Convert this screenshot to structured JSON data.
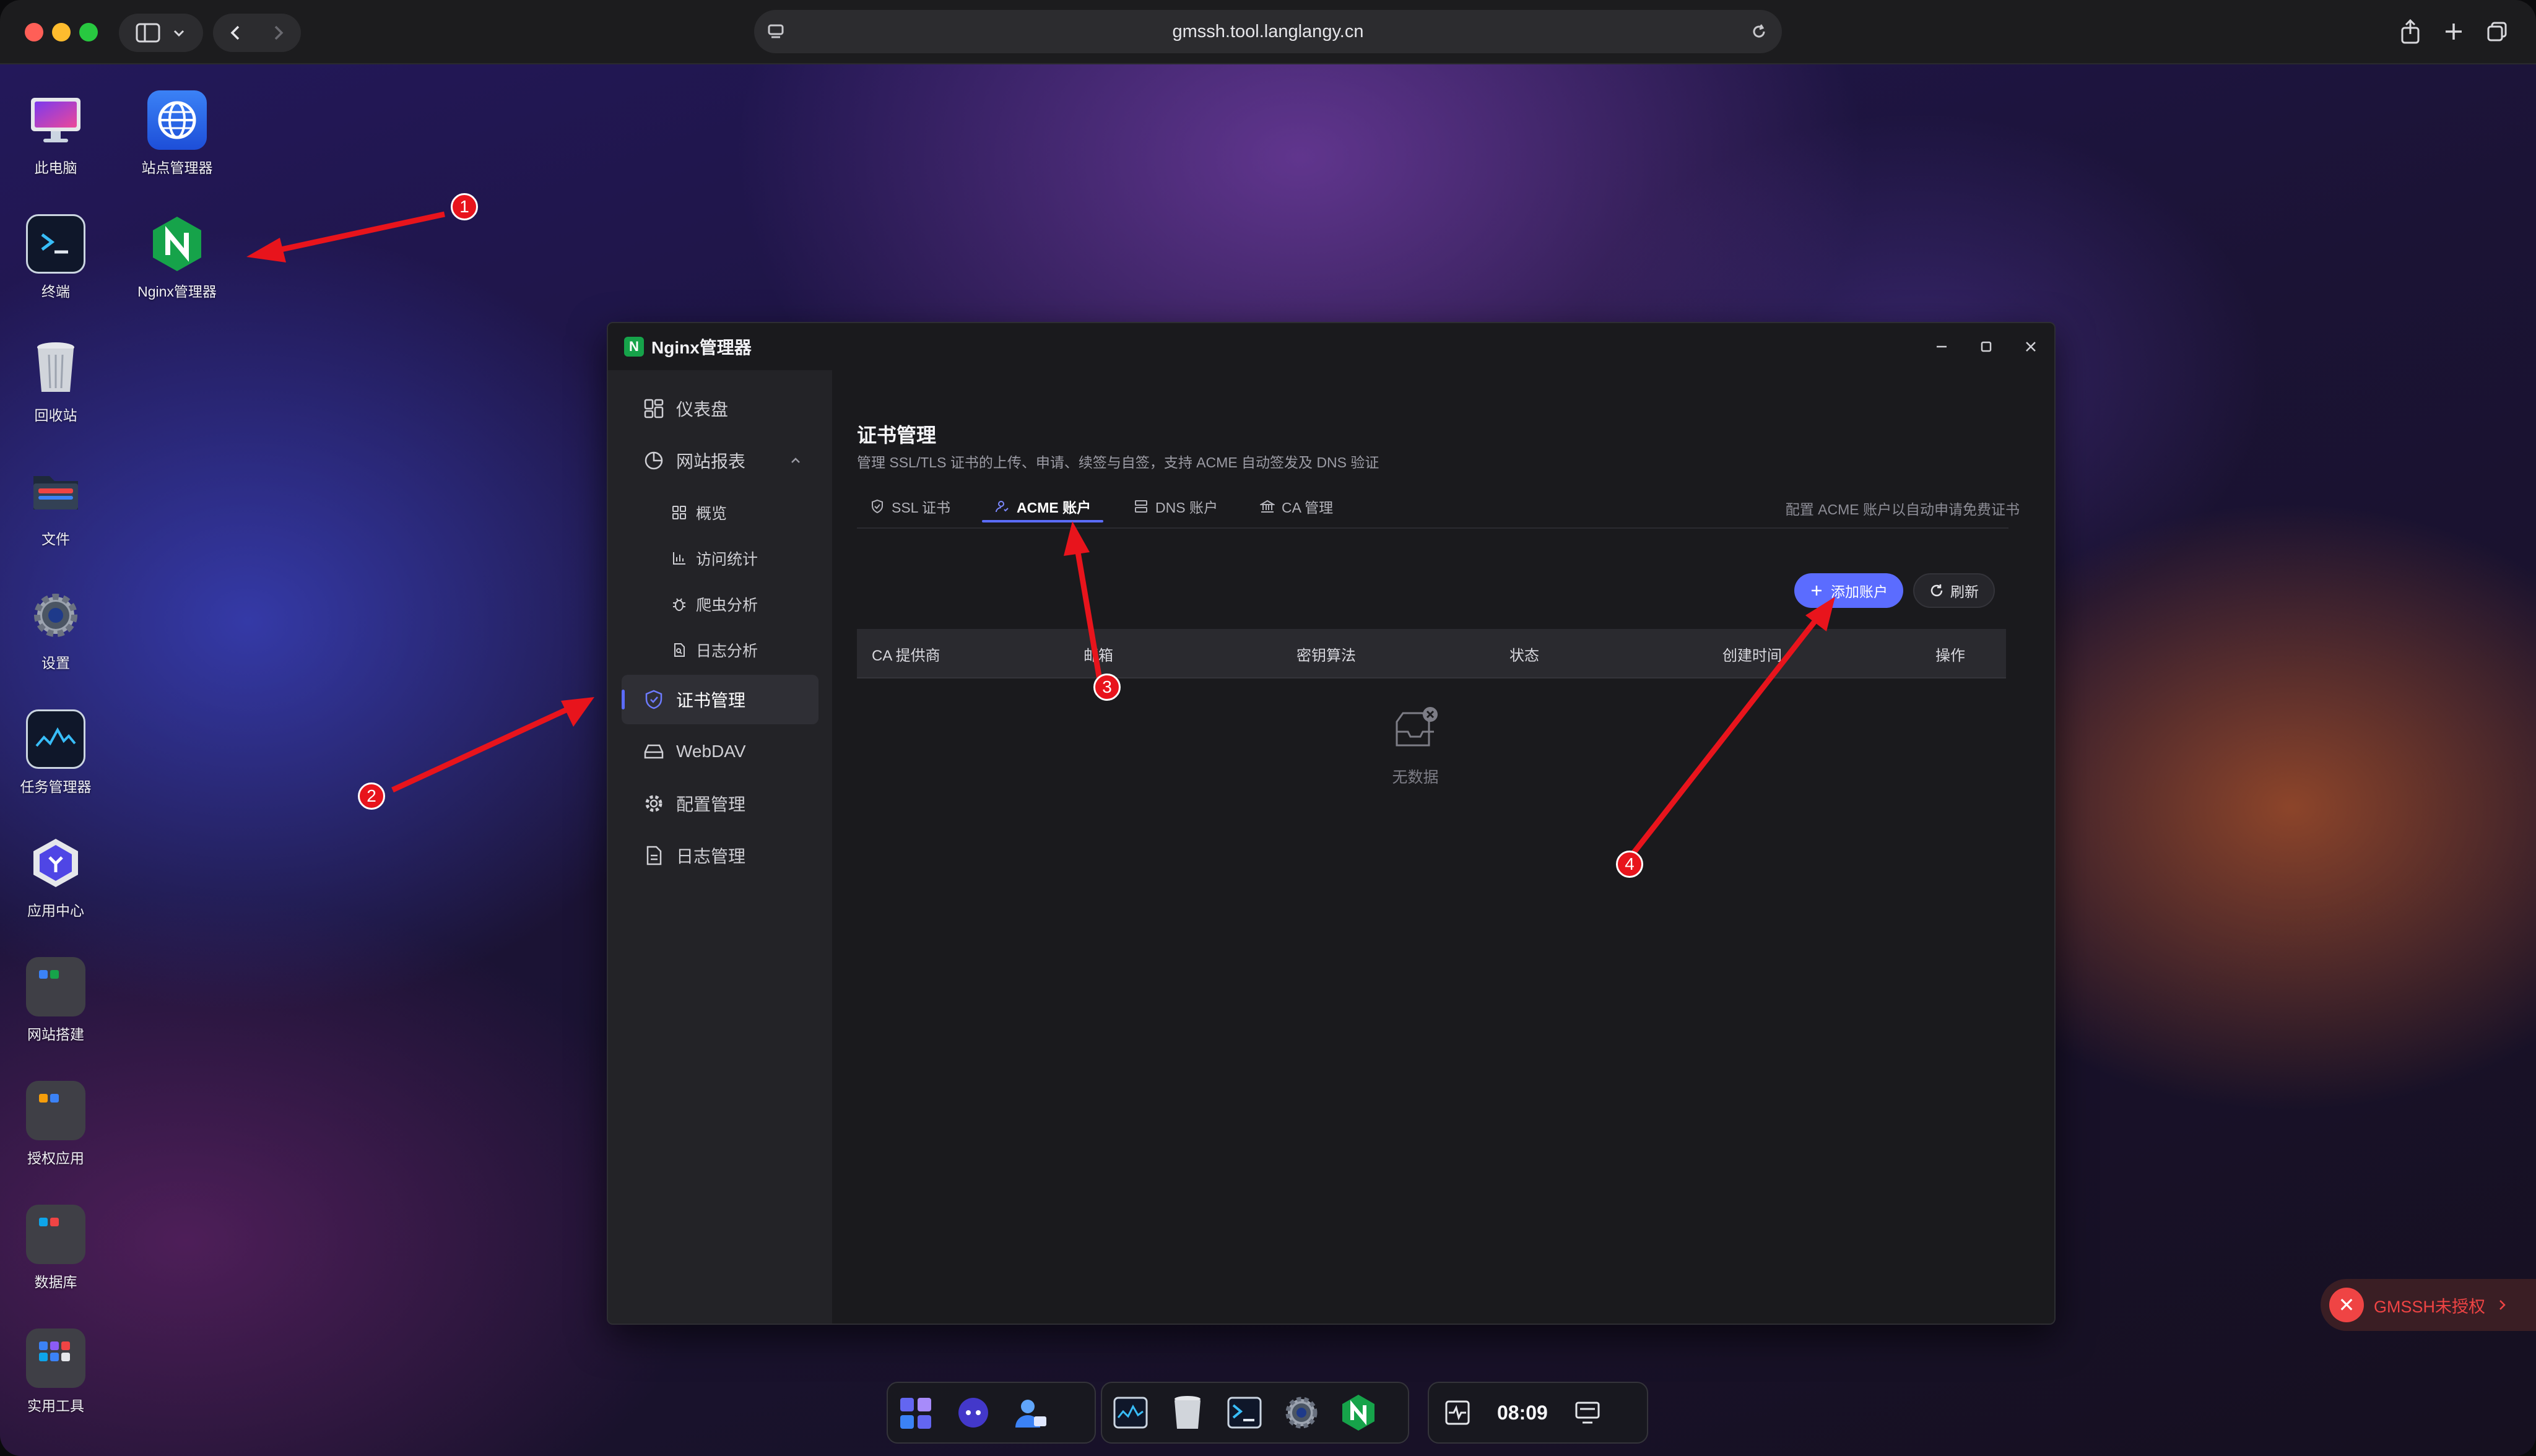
{
  "browser": {
    "url": "gmssh.tool.langlangy.cn",
    "icons": [
      "sidebar-toggle-icon",
      "chevron-down-icon",
      "back-icon",
      "forward-icon",
      "reload-icon",
      "share-icon",
      "new-tab-icon",
      "tabs-overview-icon"
    ]
  },
  "desktop": {
    "icons": [
      {
        "label": "此电脑",
        "icon": "monitor-icon"
      },
      {
        "label": "站点管理器",
        "icon": "globe-icon"
      },
      {
        "label": "终端",
        "icon": "terminal-icon"
      },
      {
        "label": "Nginx管理器",
        "icon": "nginx-icon"
      },
      {
        "label": "回收站",
        "icon": "trash-icon"
      },
      {
        "label": "文件",
        "icon": "folder-icon"
      },
      {
        "label": "设置",
        "icon": "gear-icon"
      },
      {
        "label": "任务管理器",
        "icon": "activity-icon"
      },
      {
        "label": "应用中心",
        "icon": "app-center-icon"
      },
      {
        "label": "网站搭建",
        "icon": "folder-group-icon"
      },
      {
        "label": "授权应用",
        "icon": "folder-group-icon"
      },
      {
        "label": "数据库",
        "icon": "folder-group-icon"
      },
      {
        "label": "实用工具",
        "icon": "folder-group-icon"
      }
    ]
  },
  "window": {
    "title": "Nginx管理器",
    "logo_letter": "N",
    "controls": [
      "minimize-icon",
      "maximize-icon",
      "close-icon"
    ]
  },
  "sidebar": {
    "items": [
      {
        "label": "仪表盘",
        "icon": "dashboard-icon"
      },
      {
        "label": "网站报表",
        "icon": "chart-pie-icon",
        "expanded": true
      },
      {
        "label": "概览",
        "icon": "grid-icon"
      },
      {
        "label": "访问统计",
        "icon": "bar-chart-icon"
      },
      {
        "label": "爬虫分析",
        "icon": "bug-icon"
      },
      {
        "label": "日志分析",
        "icon": "file-search-icon"
      },
      {
        "label": "证书管理",
        "icon": "shield-icon",
        "active": true
      },
      {
        "label": "WebDAV",
        "icon": "drive-icon"
      },
      {
        "label": "配置管理",
        "icon": "gear-icon"
      },
      {
        "label": "日志管理",
        "icon": "document-icon"
      }
    ]
  },
  "main": {
    "title": "证书管理",
    "description": "管理 SSL/TLS 证书的上传、申请、续签与自签，支持 ACME 自动签发及 DNS 验证",
    "tabs": [
      {
        "label": "SSL 证书",
        "icon": "shield-icon"
      },
      {
        "label": "ACME 账户",
        "icon": "user-icon",
        "active": true
      },
      {
        "label": "DNS 账户",
        "icon": "server-icon"
      },
      {
        "label": "CA 管理",
        "icon": "bank-icon"
      }
    ],
    "tab_hint": "配置 ACME 账户以自动申请免费证书",
    "add_button": "添加账户",
    "refresh_button": "刷新",
    "table": {
      "columns": [
        "CA 提供商",
        "邮箱",
        "密钥算法",
        "状态",
        "创建时间",
        "操作"
      ],
      "rows": []
    },
    "empty_text": "无数据"
  },
  "annotations": [
    "1",
    "2",
    "3",
    "4"
  ],
  "badge": {
    "text": "GMSSH未授权"
  },
  "dock": {
    "clock": "08:09",
    "items": [
      "app-grid-icon",
      "assistant-icon",
      "user-manage-icon",
      "activity-icon",
      "trash-icon",
      "terminal-icon",
      "gear-icon",
      "nginx-icon",
      "monitor-pulse-icon",
      "display-icon"
    ]
  },
  "colors": {
    "accent": "#5b6cff",
    "annotation": "#e8141c",
    "nginx": "#16a34a",
    "warning": "#ef4444"
  }
}
